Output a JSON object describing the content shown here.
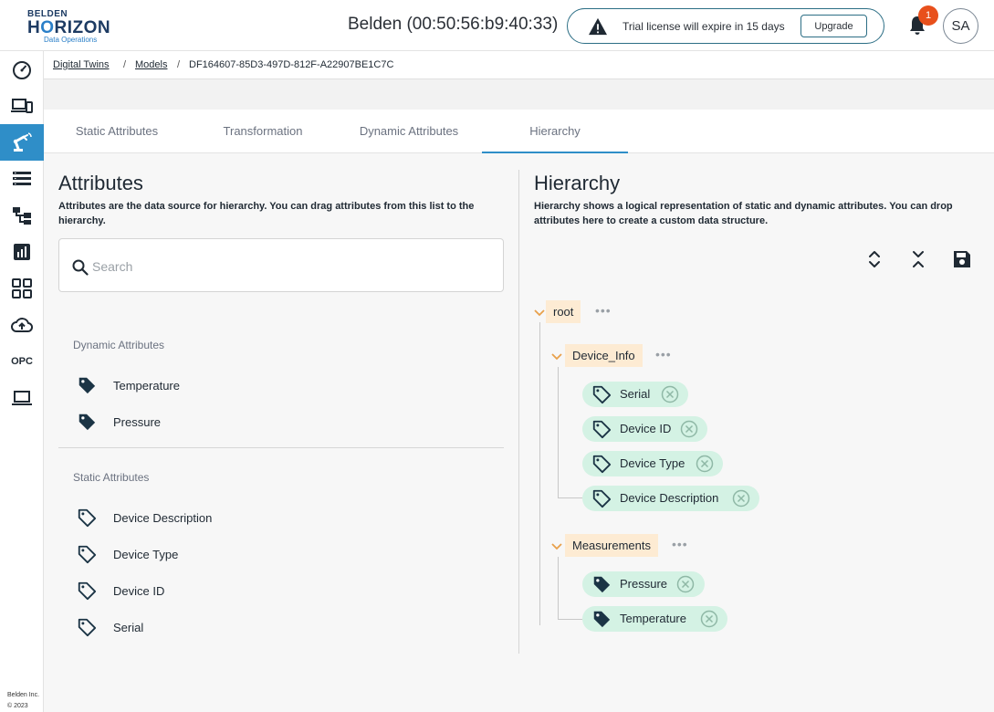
{
  "header": {
    "logo": {
      "brand": "BELDEN",
      "product_prefix": "H",
      "product_o": "O",
      "product_suffix": "RIZON",
      "tagline": "Data Operations"
    },
    "device_title": "Belden (00:50:56:b9:40:33)",
    "trial_message": "Trial license will expire in 15 days",
    "upgrade_label": "Upgrade",
    "notification_count": "1",
    "avatar_initials": "SA"
  },
  "sidebar": {
    "items": [
      {
        "icon": "dashboard-icon"
      },
      {
        "icon": "devices-icon"
      },
      {
        "icon": "robot-arm-icon",
        "active": true
      },
      {
        "icon": "list-icon"
      },
      {
        "icon": "hierarchy-icon"
      },
      {
        "icon": "analytics-icon"
      },
      {
        "icon": "apps-grid-icon"
      },
      {
        "icon": "cloud-upload-icon"
      },
      {
        "icon": "opc-icon",
        "label": "OPC"
      },
      {
        "icon": "laptop-icon"
      }
    ],
    "copyright_line1": "Belden Inc.",
    "copyright_line2": "© 2023"
  },
  "breadcrumb": {
    "items": [
      "Digital Twins",
      "Models",
      "DF164607-85D3-497D-812F-A22907BE1C7C"
    ],
    "separator": "/"
  },
  "tabs": [
    {
      "label": "Static Attributes"
    },
    {
      "label": "Transformation"
    },
    {
      "label": "Dynamic Attributes"
    },
    {
      "label": "Hierarchy",
      "active": true
    }
  ],
  "attributes_panel": {
    "title": "Attributes",
    "description": "Attributes are the data source for hierarchy. You can drag attributes from this list to the hierarchy.",
    "search_placeholder": "Search",
    "dynamic_label": "Dynamic Attributes",
    "dynamic_items": [
      "Temperature",
      "Pressure"
    ],
    "static_label": "Static Attributes",
    "static_items": [
      "Device Description",
      "Device Type",
      "Device ID",
      "Serial"
    ]
  },
  "hierarchy_panel": {
    "title": "Hierarchy",
    "description": "Hierarchy shows a logical representation of static and dynamic attributes. You can drop attributes here to create a custom data structure.",
    "root": "root",
    "groups": [
      {
        "name": "Device_Info",
        "children": [
          "Serial",
          "Device ID",
          "Device Type",
          "Device Description"
        ]
      },
      {
        "name": "Measurements",
        "children": [
          "Pressure",
          "Temperature"
        ]
      }
    ]
  },
  "colors": {
    "accent": "#2f8ec8",
    "node_bg": "#fdebd3",
    "chip_bg": "#d4f2e4",
    "badge": "#e8501c",
    "icon_dark": "#1b3445"
  }
}
